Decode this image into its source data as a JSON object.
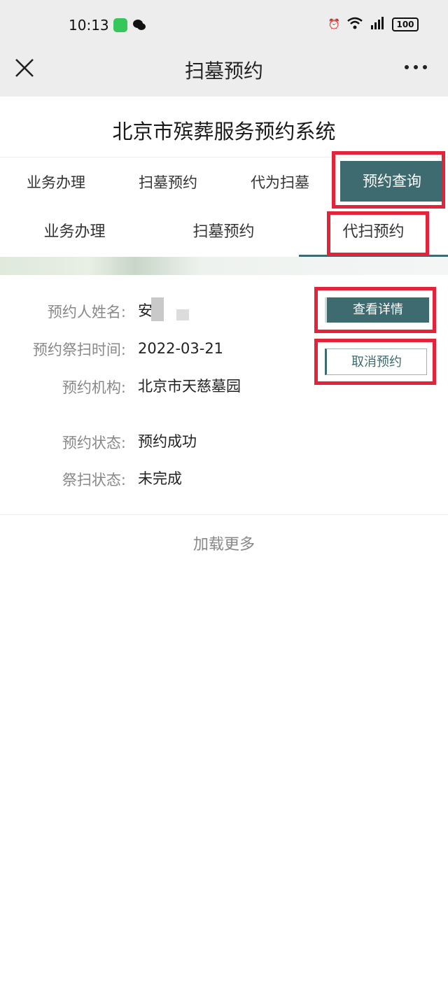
{
  "status_bar": {
    "time": "10:13",
    "battery": "100"
  },
  "nav": {
    "title": "扫墓预约"
  },
  "page_title": "北京市殡葬服务预约系统",
  "main_tabs": [
    {
      "label": "业务办理"
    },
    {
      "label": "扫墓预约"
    },
    {
      "label": "代为扫墓"
    },
    {
      "label": "预约查询"
    }
  ],
  "sub_tabs": [
    {
      "label": "业务办理"
    },
    {
      "label": "扫墓预约"
    },
    {
      "label": "代扫预约"
    }
  ],
  "record": {
    "name_label": "预约人姓名:",
    "name_value": "安",
    "time_label": "预约祭扫时间:",
    "time_value": "2022-03-21",
    "org_label": "预约机构:",
    "org_value": "北京市天慈墓园",
    "status_label": "预约状态:",
    "status_value": "预约成功",
    "visit_label": "祭扫状态:",
    "visit_value": "未完成",
    "detail_button": "查看详情",
    "cancel_button": "取消预约"
  },
  "load_more": "加载更多",
  "colors": {
    "accent": "#3d6b70",
    "highlight": "#e2243a",
    "navbar_bg": "#ededed"
  }
}
